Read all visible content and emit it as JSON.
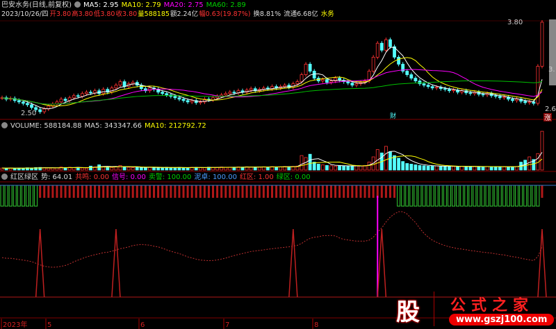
{
  "header": {
    "title": "巴安水务(日线,前复权)",
    "ma5": "MA5: 2.95",
    "ma10": "MA10: 2.79",
    "ma20": "MA20: 2.75",
    "ma60": "MA60: 2.89"
  },
  "quote": {
    "date": "2023/10/26/四",
    "open_l": "开",
    "open": "3.80",
    "high_l": "高",
    "high": "3.80",
    "low_l": "低",
    "low": "3.80",
    "close_l": "收",
    "close": "3.80",
    "vol_l": "量",
    "vol": "588185",
    "amt_l": "额",
    "amt": "2.24亿",
    "chg_l": "幅",
    "chg": "0.63(19.87%)",
    "turn": "换8.81%",
    "float": "流通6.68亿",
    "sector": "水务"
  },
  "price_labels": {
    "high": "3.80",
    "low": "2.50",
    "right_mid": "3.",
    "right_low": "2.6",
    "cai": "财",
    "zhang": "涨"
  },
  "volume": {
    "label": "VOLUME: 588184.88",
    "ma5": "MA5: 343347.66",
    "ma10": "MA10: 212792.72"
  },
  "indicator": {
    "name": "红区绿区",
    "shi": "势: 64.01",
    "gongming": "共鸣: 0.00",
    "xinhao": "信号: 0.00",
    "maijing": "卖警: 100.00",
    "nizhuo": "泥卓: 100.00",
    "hongqu": "红区: 1.00",
    "lvqu": "绿区: 0.00"
  },
  "xaxis": {
    "labels": [
      "2023年",
      "5",
      "6",
      "7",
      "8"
    ]
  },
  "logo": {
    "char": "股",
    "name": "公式之家",
    "url": "www.gszj100.com"
  },
  "colors": {
    "up": "#ff3232",
    "down": "#54ffff",
    "ma5": "#ffffff",
    "ma10": "#ffff00",
    "ma20": "#ff00ff",
    "ma60": "#00c000"
  },
  "chart_data": {
    "type": "candlestick",
    "ylim": [
      2.5,
      3.8
    ],
    "close": [
      2.72,
      2.7,
      2.71,
      2.68,
      2.66,
      2.64,
      2.62,
      2.58,
      2.55,
      2.52,
      2.56,
      2.6,
      2.63,
      2.66,
      2.7,
      2.68,
      2.72,
      2.75,
      2.74,
      2.78,
      2.8,
      2.79,
      2.82,
      2.78,
      2.84,
      2.8,
      2.86,
      2.9,
      2.95,
      2.88,
      2.92,
      2.94,
      2.9,
      2.85,
      2.82,
      2.86,
      2.84,
      2.8,
      2.78,
      2.76,
      2.74,
      2.72,
      2.7,
      2.68,
      2.66,
      2.68,
      2.65,
      2.66,
      2.7,
      2.69,
      2.72,
      2.74,
      2.76,
      2.78,
      2.8,
      2.79,
      2.82,
      2.8,
      2.83,
      2.85,
      2.82,
      2.84,
      2.86,
      2.85,
      2.88,
      2.86,
      2.88,
      2.9,
      2.87,
      2.92,
      2.95,
      3.05,
      3.2,
      3.1,
      3.0,
      2.96,
      2.98,
      2.94,
      2.96,
      3.0,
      2.97,
      2.95,
      2.93,
      2.9,
      2.92,
      2.94,
      2.96,
      3.1,
      3.3,
      3.5,
      3.4,
      3.55,
      3.45,
      3.3,
      3.2,
      3.1,
      3.05,
      3.0,
      2.96,
      2.92,
      2.9,
      2.88,
      2.86,
      2.87,
      2.85,
      2.84,
      2.82,
      2.83,
      2.8,
      2.82,
      2.79,
      2.78,
      2.8,
      2.77,
      2.76,
      2.78,
      2.75,
      2.74,
      2.72,
      2.73,
      2.7,
      2.68,
      2.7,
      2.67,
      2.65,
      2.66,
      2.64,
      3.17,
      3.8
    ],
    "volume": [
      30000,
      28000,
      32000,
      26000,
      30000,
      27000,
      35000,
      31000,
      38000,
      40000,
      36000,
      30000,
      34000,
      33000,
      45000,
      38000,
      42000,
      36000,
      40000,
      32000,
      30000,
      60000,
      48000,
      80000,
      52000,
      45000,
      40000,
      50000,
      70000,
      45000,
      42000,
      38000,
      46000,
      40000,
      36000,
      44000,
      38000,
      35000,
      40000,
      42000,
      38000,
      36000,
      40000,
      38000,
      35000,
      42000,
      40000,
      38000,
      36000,
      44000,
      40000,
      42000,
      46000,
      40000,
      44000,
      42000,
      48000,
      45000,
      50000,
      44000,
      46000,
      48000,
      50000,
      46000,
      52000,
      48000,
      50000,
      54000,
      52000,
      56000,
      60000,
      220000,
      190000,
      240000,
      120000,
      90000,
      80000,
      70000,
      65000,
      60000,
      70000,
      65000,
      60000,
      58000,
      62000,
      64000,
      70000,
      120000,
      200000,
      310000,
      260000,
      360000,
      280000,
      220000,
      180000,
      130000,
      100000,
      90000,
      80000,
      70000,
      65000,
      60000,
      58000,
      62000,
      58000,
      55000,
      60000,
      54000,
      52000,
      58000,
      54000,
      52000,
      56000,
      50000,
      52000,
      54000,
      50000,
      48000,
      52000,
      50000,
      48000,
      52000,
      54000,
      120000,
      150000,
      200000,
      160000,
      250000,
      588185
    ],
    "signal_spikes": [
      9,
      27,
      69,
      90,
      128
    ],
    "signal_line": 89,
    "green_zone": [
      [
        0,
        8
      ],
      [
        94,
        127
      ]
    ]
  }
}
